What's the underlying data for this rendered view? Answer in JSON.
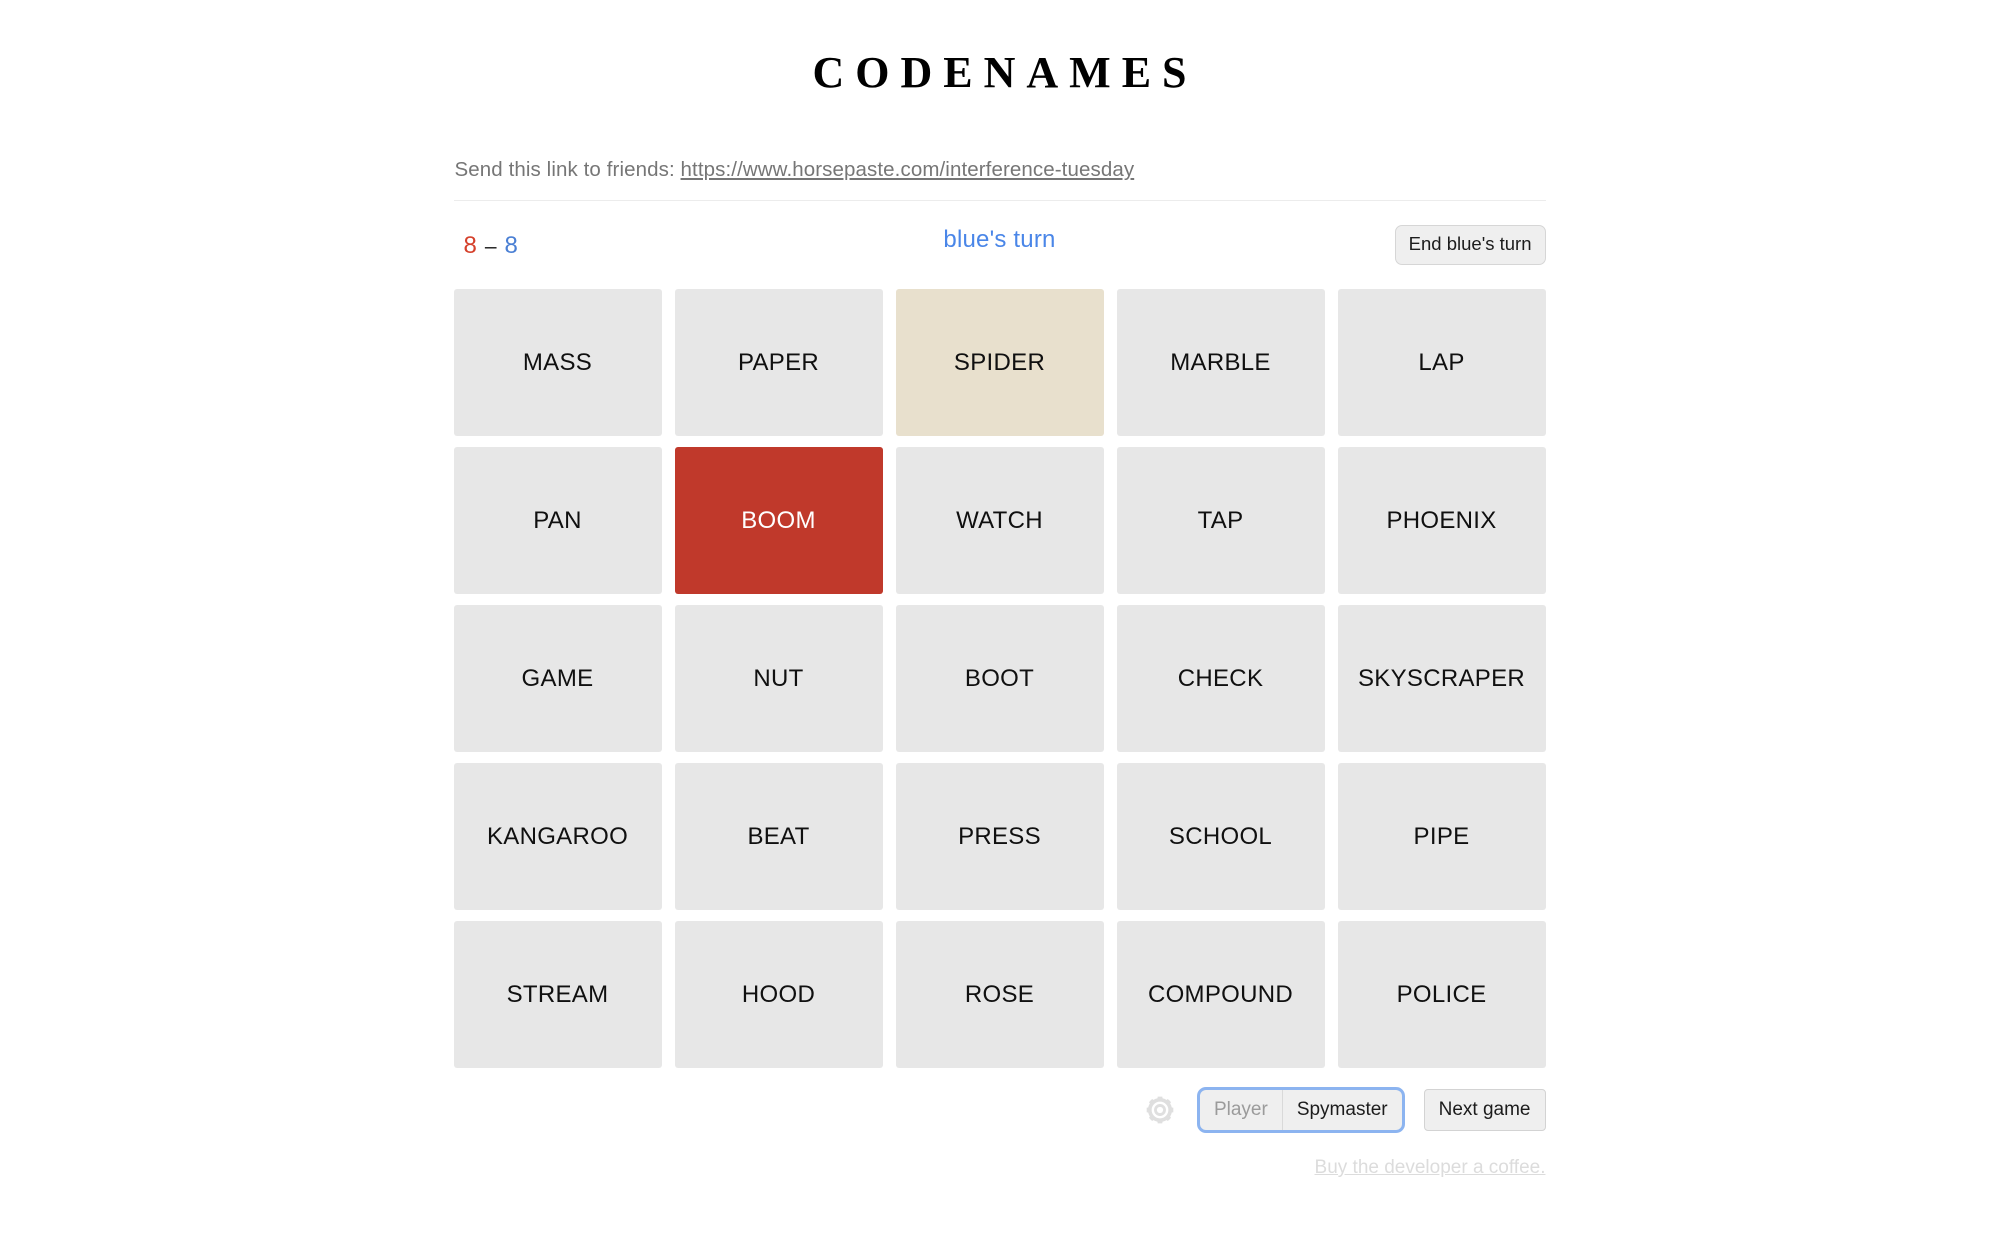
{
  "app": {
    "title": "CODENAMES"
  },
  "share": {
    "prefix": "Send this link to friends:",
    "url": "https://www.horsepaste.com/interference-tuesday"
  },
  "status": {
    "red_score": "8",
    "dash": "–",
    "blue_score": "8",
    "turn_text": "blue's turn",
    "end_turn_label": "End blue's turn",
    "red_color": "#d5402b",
    "blue_color": "#4a86e8"
  },
  "board": {
    "rows": 5,
    "cols": 5,
    "cards": [
      {
        "word": "MASS",
        "state": "hidden"
      },
      {
        "word": "PAPER",
        "state": "hidden"
      },
      {
        "word": "SPIDER",
        "state": "revealed-neutral"
      },
      {
        "word": "MARBLE",
        "state": "hidden"
      },
      {
        "word": "LAP",
        "state": "hidden"
      },
      {
        "word": "PAN",
        "state": "hidden"
      },
      {
        "word": "BOOM",
        "state": "revealed-red"
      },
      {
        "word": "WATCH",
        "state": "hidden"
      },
      {
        "word": "TAP",
        "state": "hidden"
      },
      {
        "word": "PHOENIX",
        "state": "hidden"
      },
      {
        "word": "GAME",
        "state": "hidden"
      },
      {
        "word": "NUT",
        "state": "hidden"
      },
      {
        "word": "BOOT",
        "state": "hidden"
      },
      {
        "word": "CHECK",
        "state": "hidden"
      },
      {
        "word": "SKYSCRAPER",
        "state": "hidden"
      },
      {
        "word": "KANGAROO",
        "state": "hidden"
      },
      {
        "word": "BEAT",
        "state": "hidden"
      },
      {
        "word": "PRESS",
        "state": "hidden"
      },
      {
        "word": "SCHOOL",
        "state": "hidden"
      },
      {
        "word": "PIPE",
        "state": "hidden"
      },
      {
        "word": "STREAM",
        "state": "hidden"
      },
      {
        "word": "HOOD",
        "state": "hidden"
      },
      {
        "word": "ROSE",
        "state": "hidden"
      },
      {
        "word": "COMPOUND",
        "state": "hidden"
      },
      {
        "word": "POLICE",
        "state": "hidden"
      }
    ]
  },
  "controls": {
    "settings_icon": "gear-icon",
    "player_label": "Player",
    "spymaster_label": "Spymaster",
    "selected_role": "Player",
    "next_game_label": "Next game"
  },
  "footer": {
    "coffee_label": "Buy the developer a coffee."
  }
}
